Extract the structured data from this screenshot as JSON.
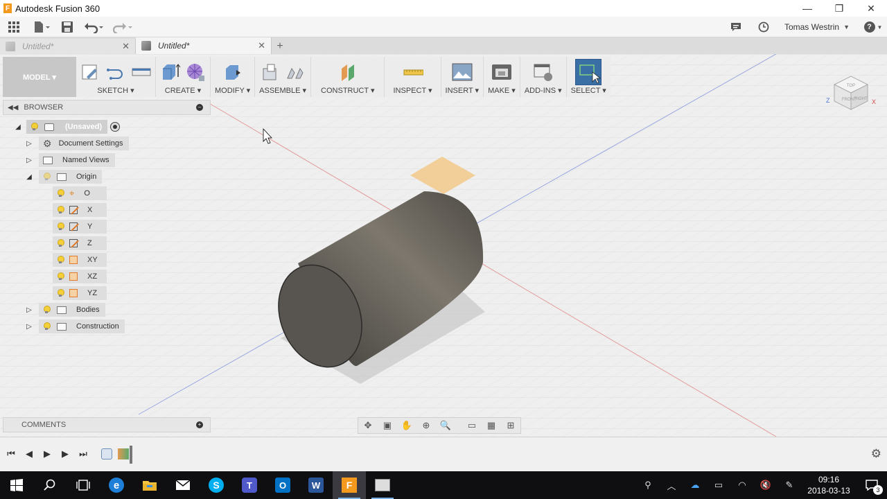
{
  "window": {
    "title": "Autodesk Fusion 360",
    "app_icon_letter": "F",
    "minimize": "—",
    "maximize": "❐",
    "close": "✕"
  },
  "quickbar": {
    "user_name": "Tomas Westrin",
    "help": "?"
  },
  "tabs": [
    {
      "label": "Untitled*",
      "state": "inactive"
    },
    {
      "label": "Untitled*",
      "state": "active"
    }
  ],
  "toolbar": {
    "workspace": "MODEL ▾",
    "groups": [
      {
        "label": "SKETCH ▾"
      },
      {
        "label": "CREATE ▾"
      },
      {
        "label": "MODIFY ▾"
      },
      {
        "label": "ASSEMBLE ▾"
      },
      {
        "label": "CONSTRUCT ▾"
      },
      {
        "label": "INSPECT ▾"
      },
      {
        "label": "INSERT ▾"
      },
      {
        "label": "MAKE ▾"
      },
      {
        "label": "ADD-INS ▾"
      },
      {
        "label": "SELECT ▾"
      }
    ]
  },
  "browser": {
    "title": "BROWSER",
    "root": "(Unsaved)",
    "items": [
      {
        "label": "Document Settings"
      },
      {
        "label": "Named Views"
      },
      {
        "label": "Origin"
      },
      {
        "label": "O"
      },
      {
        "label": "X"
      },
      {
        "label": "Y"
      },
      {
        "label": "Z"
      },
      {
        "label": "XY"
      },
      {
        "label": "XZ"
      },
      {
        "label": "YZ"
      },
      {
        "label": "Bodies"
      },
      {
        "label": "Construction"
      }
    ]
  },
  "comments": {
    "title": "COMMENTS"
  },
  "viewcube": {
    "front": "FRONT",
    "right": "RIGHT",
    "top": "TOP",
    "axis_z": "Z",
    "axis_x": "X"
  },
  "colors": {
    "accent": "#3a6fa6",
    "bulb": "#f5cf3a",
    "cylinder": "#5f5c55",
    "plane": "#f2c98a"
  },
  "taskbar": {
    "time": "09:16",
    "date": "2018-03-13",
    "notifications": "3"
  }
}
